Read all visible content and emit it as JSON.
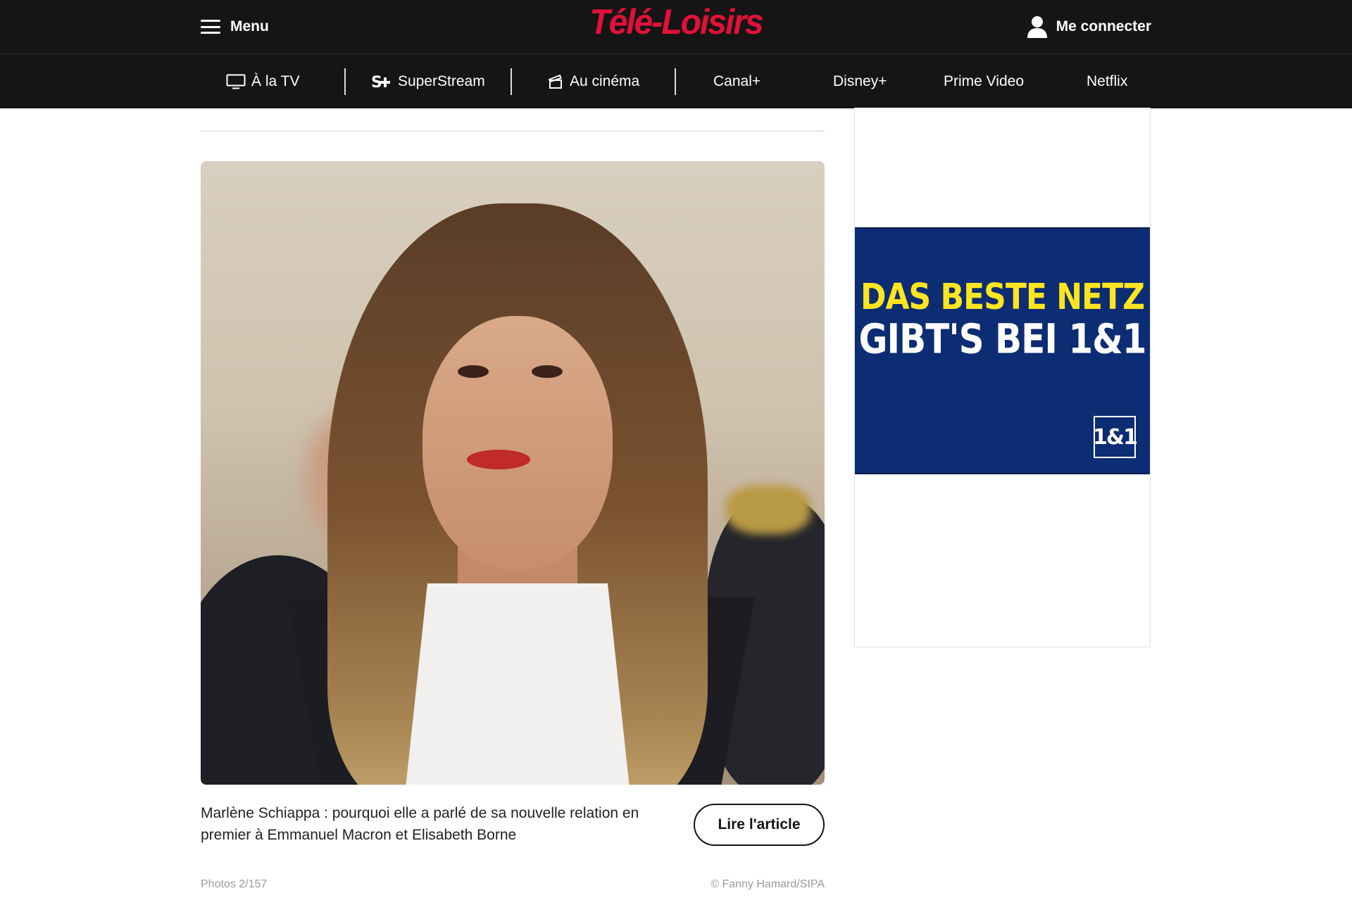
{
  "header": {
    "menu_label": "Menu",
    "logo_text": "Télé-Loisirs",
    "login_label": "Me connecter"
  },
  "nav": {
    "items": [
      {
        "label": "À la TV",
        "icon": "tv-icon"
      },
      {
        "label": "SuperStream",
        "icon": "superstream-icon"
      },
      {
        "label": "Au cinéma",
        "icon": "clapperboard-icon"
      },
      {
        "label": "Canal+"
      },
      {
        "label": "Disney+"
      },
      {
        "label": "Prime Video"
      },
      {
        "label": "Netflix"
      }
    ]
  },
  "gallery": {
    "caption": "Marlène Schiappa : pourquoi elle a parlé de sa nouvelle relation en premier à Emmanuel Macron et Elisabeth Borne",
    "read_button": "Lire l'article",
    "photo_count": "Photos 2/157",
    "credit": "© Fanny Hamard/SIPA"
  },
  "ad": {
    "line1": "DAS BESTE NETZ",
    "line2": "GIBT'S BEI 1&1",
    "logo": "1&1"
  },
  "colors": {
    "header_bg": "#151515",
    "brand_red": "#e3103a",
    "ad_bg": "#0c2d73",
    "ad_yellow": "#ffe51f"
  }
}
